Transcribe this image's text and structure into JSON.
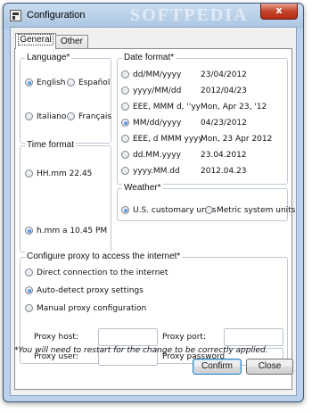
{
  "window": {
    "title": "Configuration",
    "watermark": "SOFTPEDIA",
    "close_label": "x"
  },
  "tabs": [
    {
      "label": "General",
      "active": true
    },
    {
      "label": "Other",
      "active": false
    }
  ],
  "language": {
    "legend": "Language*",
    "options": [
      {
        "label": "English",
        "checked": true
      },
      {
        "label": "Español",
        "checked": false
      },
      {
        "label": "Italiano",
        "checked": false
      },
      {
        "label": "Français",
        "checked": false
      }
    ]
  },
  "time_format": {
    "legend": "Time format",
    "options": [
      {
        "label": "HH.mm 22.45",
        "checked": false
      },
      {
        "label": "h.mm a  10.45 PM",
        "checked": true
      }
    ]
  },
  "date_format": {
    "legend": "Date format*",
    "options": [
      {
        "pattern": "dd/MM/yyyy",
        "sample": "23/04/2012",
        "checked": false
      },
      {
        "pattern": "yyyy/MM/dd",
        "sample": "2012/04/23",
        "checked": false
      },
      {
        "pattern": "EEE, MMM d, ''yy",
        "sample": "Mon, Apr 23, '12",
        "checked": false
      },
      {
        "pattern": "MM/dd/yyyy",
        "sample": "04/23/2012",
        "checked": true
      },
      {
        "pattern": "EEE, d MMM yyyy",
        "sample": "Mon, 23 Apr 2012",
        "checked": false
      },
      {
        "pattern": "dd.MM.yyyy",
        "sample": "23.04.2012",
        "checked": false
      },
      {
        "pattern": "yyyy.MM.dd",
        "sample": "2012.04.23",
        "checked": false
      }
    ]
  },
  "weather": {
    "legend": "Weather*",
    "options": [
      {
        "label": "U.S. customary units",
        "checked": true
      },
      {
        "label": "Metric system units",
        "checked": false
      }
    ]
  },
  "proxy": {
    "legend": "Configure proxy to access the internet*",
    "options": [
      {
        "label": "Direct connection to the internet",
        "checked": false
      },
      {
        "label": "Auto-detect proxy settings",
        "checked": true
      },
      {
        "label": "Manual proxy configuration",
        "checked": false
      }
    ],
    "host_label": "Proxy host:",
    "host_value": "",
    "port_label": "Proxy port:",
    "port_value": "",
    "user_label": "Proxy user:",
    "user_value": "",
    "password_label": "Proxy password:",
    "password_value": ""
  },
  "note": "*You will need to restart for the change to be correctly applied.",
  "buttons": {
    "confirm": "Confirm",
    "close": "Close"
  }
}
